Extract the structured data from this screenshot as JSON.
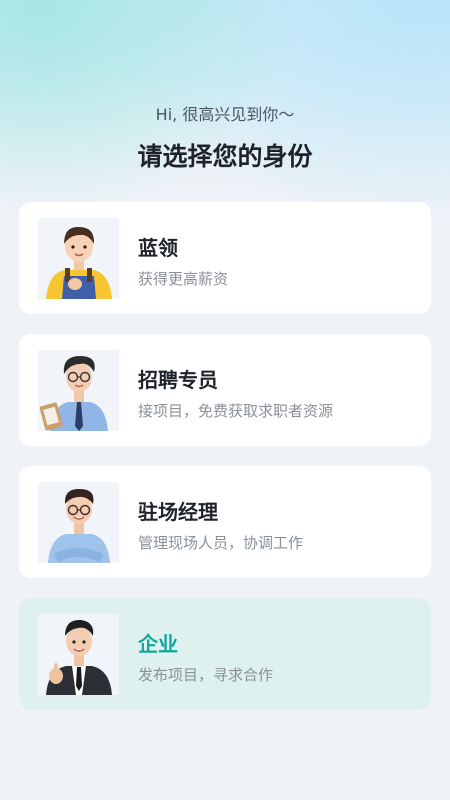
{
  "header": {
    "greeting": "Hi, 很高兴见到你～",
    "title": "请选择您的身份"
  },
  "roles": [
    {
      "title": "蓝领",
      "desc": "获得更高薪资",
      "selected": false,
      "avatar": "blue-collar-worker-avatar"
    },
    {
      "title": "招聘专员",
      "desc": "接项目，免费获取求职者资源",
      "selected": false,
      "avatar": "recruiter-avatar"
    },
    {
      "title": "驻场经理",
      "desc": "管理现场人员，协调工作",
      "selected": false,
      "avatar": "site-manager-avatar"
    },
    {
      "title": "企业",
      "desc": "发布项目，寻求合作",
      "selected": true,
      "avatar": "enterprise-avatar"
    }
  ],
  "colors": {
    "accent": "#12a69a",
    "selected_card_bg": "#dff1ee",
    "card_bg": "#ffffff",
    "page_bg": "#eff2f7"
  }
}
